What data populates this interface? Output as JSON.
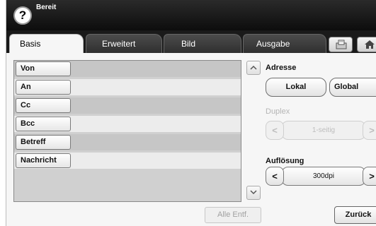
{
  "status": {
    "text": "Bereit",
    "help_label": "?"
  },
  "tabs": [
    {
      "label": "Basis",
      "active": true
    },
    {
      "label": "Erweitert",
      "active": false
    },
    {
      "label": "Bild",
      "active": false
    },
    {
      "label": "Ausgabe",
      "active": false
    }
  ],
  "toolbar_icons": [
    "copy-icon",
    "home-icon"
  ],
  "address_fields": [
    {
      "label": "Von"
    },
    {
      "label": "An"
    },
    {
      "label": "Cc"
    },
    {
      "label": "Bcc"
    },
    {
      "label": "Betreff"
    },
    {
      "label": "Nachricht"
    }
  ],
  "list_actions": {
    "clear_all": "Alle Entf."
  },
  "adresse": {
    "label": "Adresse",
    "lokal": "Lokal",
    "global": "Global"
  },
  "duplex": {
    "label": "Duplex",
    "value": "1-seitig",
    "enabled": false
  },
  "aufloesung": {
    "label": "Auflösung",
    "value": "300dpi"
  },
  "footer": {
    "back": "Zurück"
  },
  "stepper_glyphs": {
    "left": "<",
    "right": ">"
  }
}
